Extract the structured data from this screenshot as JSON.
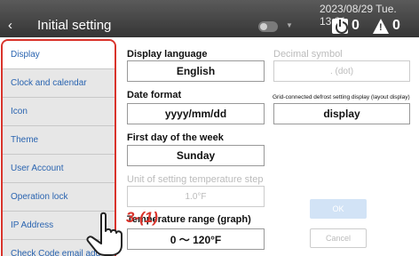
{
  "header": {
    "back_icon": "‹",
    "title": "Initial setting",
    "datetime": "2023/08/29 Tue. 13:21",
    "power_count": "0",
    "alarm_count": "0"
  },
  "sidebar": {
    "items": [
      {
        "label": "Display"
      },
      {
        "label": "Clock and calendar"
      },
      {
        "label": "Icon"
      },
      {
        "label": "Theme"
      },
      {
        "label": "User Account"
      },
      {
        "label": "Operation lock"
      },
      {
        "label": "IP Address"
      },
      {
        "label": "Check Code email add"
      }
    ]
  },
  "main": {
    "display_language_label": "Display language",
    "display_language_value": "English",
    "decimal_symbol_label": "Decimal symbol",
    "decimal_symbol_value": ". (dot)",
    "date_format_label": "Date format",
    "date_format_value": "yyyy/mm/dd",
    "defrost_label": "Grid-connected defrost setting display (layout display)",
    "defrost_value": "display",
    "first_day_label": "First day of the week",
    "first_day_value": "Sunday",
    "unit_step_label": "Unit of setting temperature step",
    "unit_step_value": "1.0°F",
    "temp_range_label": "Temperature range (graph)",
    "temp_range_value": "0 〜 120°F",
    "ok_label": "OK",
    "cancel_label": "Cancel"
  },
  "annotation": {
    "callout": "3-(1)"
  },
  "colors": {
    "accent_red": "#d9332b",
    "link_blue": "#2a64b0",
    "header_dark": "#404040"
  }
}
